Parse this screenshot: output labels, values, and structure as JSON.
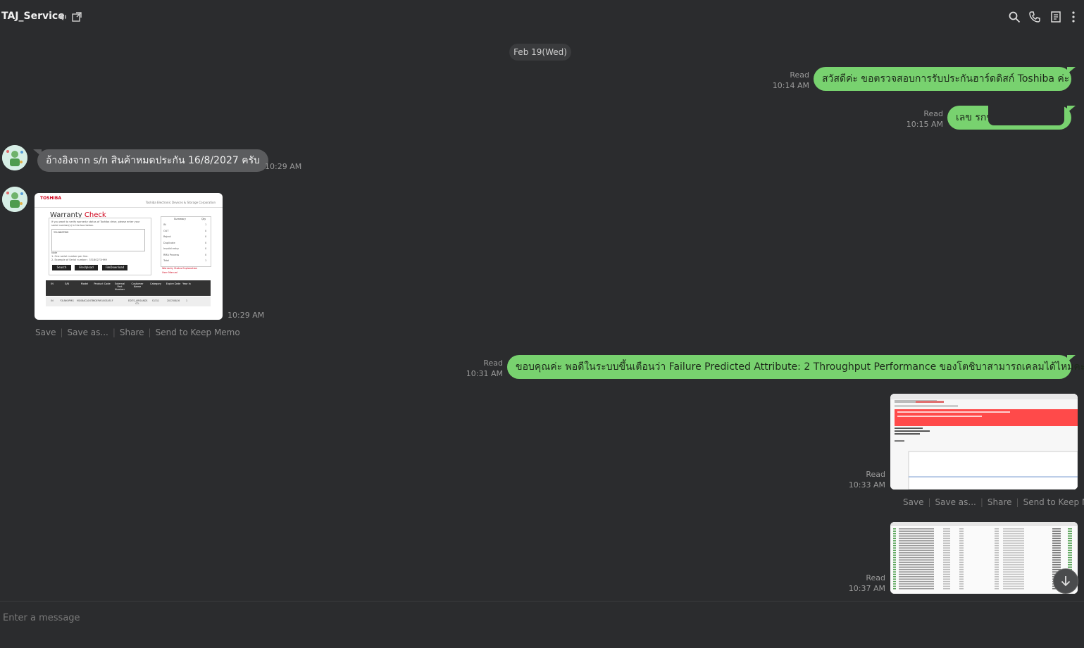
{
  "header": {
    "title": "TAJ_Service",
    "icons": [
      "speaker-icon",
      "popout-icon",
      "search-icon",
      "phone-icon",
      "notes-icon",
      "more-icon"
    ]
  },
  "date_separator": "Feb 19(Wed)",
  "messages": [
    {
      "dir": "out",
      "status": "Read",
      "time": "10:14 AM",
      "text": "สวัสดีค่ะ  ขอตรวจสอบการรับประกันฮาร์ดดิสก์ Toshiba ค่ะ"
    },
    {
      "dir": "out",
      "status": "Read",
      "time": "10:15 AM",
      "text": "เลข รกข"
    },
    {
      "dir": "in",
      "time": "10:29 AM",
      "text": "อ้างอิงจาก s/n สินค้าหมดประกัน 16/8/2027 ครับ"
    },
    {
      "dir": "in",
      "time": "10:29 AM",
      "type": "image",
      "image": {
        "brand": "TOSHIBA",
        "corp": "Toshiba Electronic Devices & Storage Corporation",
        "title_1": "Warranty",
        "title_2": "Check",
        "hint": "If you want to verify warranty status of Toshiba drive, please enter your serial number(s) in the box below.",
        "serial": "Y2LNK0PMG",
        "note": "Note",
        "note_1": "1. One serial number per line.",
        "note_2": "2. Example of Serial number : 33180271HHH",
        "buttons": [
          "Search",
          "FileUpload",
          "FileDownload"
        ],
        "summary_head": [
          "Summary",
          "Qty"
        ],
        "summary_rows": [
          [
            "IN",
            "1"
          ],
          [
            "OUT",
            "0"
          ],
          [
            "Reject",
            "0"
          ],
          [
            "Duplicate",
            "0"
          ],
          [
            "Invalid entry",
            "0"
          ],
          [
            "RMA Process",
            "0"
          ],
          [
            "Total",
            "1"
          ]
        ],
        "links": [
          "Warranty Status Explanation",
          "User Manual"
        ],
        "table_head": [
          "IN",
          "S/N",
          "Model",
          "Product Code",
          "External Part Number",
          "Customer Name",
          "Category",
          "Expire Date",
          "Year In"
        ],
        "table_row": [
          "IN",
          "Y2LNK0PMG",
          "MG08ACA16TE",
          "HDEPW10GEA51F",
          "",
          "EDITS_ARISANDS CO.",
          "S1311",
          "2027/08/16",
          "1"
        ]
      }
    },
    {
      "dir": "out",
      "status": "Read",
      "time": "10:31 AM",
      "text": "ขอบคุณค่ะ พอดีในระบบขึ้นเตือนว่า Failure Predicted Attribute: 2 Throughput Performance ของโตชิบาสามารถเคลมได้ไหมคะ"
    },
    {
      "dir": "out",
      "status": "Read",
      "time": "10:33 AM",
      "type": "image"
    },
    {
      "dir": "out",
      "status": "Read",
      "time": "10:37 AM",
      "type": "image"
    }
  ],
  "image_actions": [
    "Save",
    "Save as...",
    "Share",
    "Send to Keep Memo"
  ],
  "input": {
    "placeholder": "Enter a message"
  },
  "colors": {
    "background": "#2b2c2e",
    "outgoing_bubble": "#78d26f",
    "incoming_bubble": "#5b5c5e"
  }
}
